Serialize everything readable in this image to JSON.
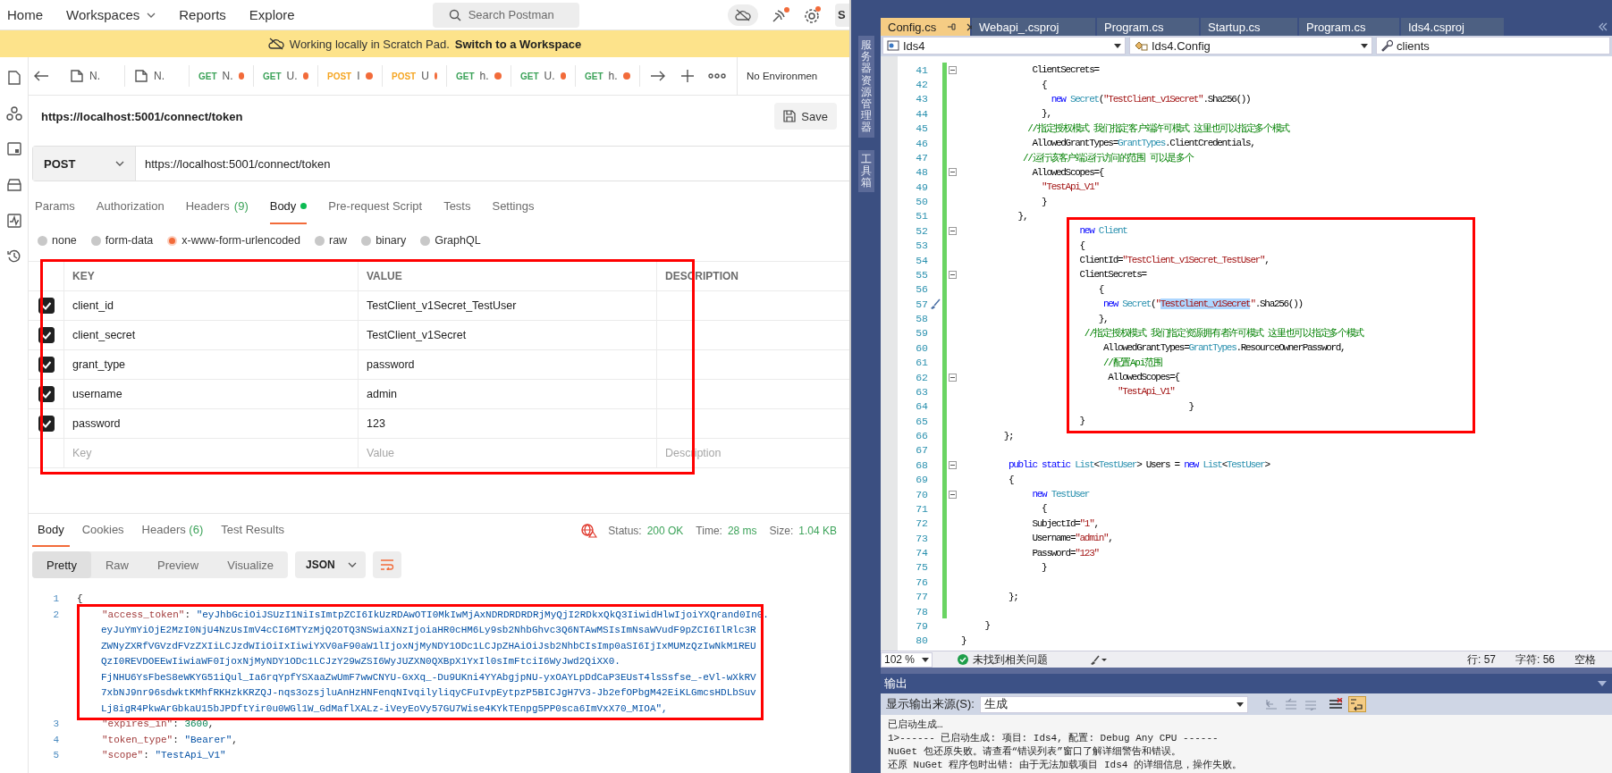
{
  "postman": {
    "nav": {
      "items": [
        {
          "label": "Home",
          "dropdown": false
        },
        {
          "label": "Workspaces",
          "dropdown": true
        },
        {
          "label": "Reports",
          "dropdown": false
        },
        {
          "label": "Explore",
          "dropdown": false
        }
      ],
      "search": {
        "placeholder": "Search Postman"
      },
      "account": "S"
    },
    "banner": {
      "text": "Working locally in Scratch Pad.",
      "link": "Switch to a Workspace"
    },
    "request_tabs": [
      {
        "kind": "doc",
        "name": "N."
      },
      {
        "kind": "doc",
        "name": "N."
      },
      {
        "kind": "request",
        "method": "GET",
        "color": "#3da35a",
        "name": "N.",
        "unsaved": true
      },
      {
        "kind": "request",
        "method": "GET",
        "color": "#3da35a",
        "name": "U.",
        "unsaved": true
      },
      {
        "kind": "request",
        "method": "POST",
        "color": "#f5a623",
        "name": "I",
        "unsaved": true
      },
      {
        "kind": "request",
        "method": "POST",
        "color": "#f5a623",
        "name": "U",
        "unsaved": true
      },
      {
        "kind": "request",
        "method": "GET",
        "color": "#3da35a",
        "name": "h.",
        "unsaved": true
      },
      {
        "kind": "request",
        "method": "GET",
        "color": "#3da35a",
        "name": "U.",
        "unsaved": true
      },
      {
        "kind": "request",
        "method": "GET",
        "color": "#3da35a",
        "name": "h.",
        "unsaved": true
      }
    ],
    "environment": "No Environmen",
    "request": {
      "title": "https://localhost:5001/connect/token",
      "save": "Save",
      "method": "POST",
      "url": "https://localhost:5001/connect/token"
    },
    "request_sections": [
      {
        "label": "Params",
        "dot": false,
        "selected": false
      },
      {
        "label": "Authorization",
        "dot": false,
        "selected": false
      },
      {
        "label": "Headers",
        "count": "(9)",
        "dot": false,
        "selected": false
      },
      {
        "label": "Body",
        "dot": true,
        "selected": true
      },
      {
        "label": "Pre-request Script",
        "dot": false,
        "selected": false
      },
      {
        "label": "Tests",
        "dot": false,
        "selected": false
      },
      {
        "label": "Settings",
        "dot": false,
        "selected": false
      }
    ],
    "body_types": [
      {
        "label": "none",
        "selected": false
      },
      {
        "label": "form-data",
        "selected": false
      },
      {
        "label": "x-www-form-urlencoded",
        "selected": true
      },
      {
        "label": "raw",
        "selected": false
      },
      {
        "label": "binary",
        "selected": false
      },
      {
        "label": "GraphQL",
        "selected": false
      }
    ],
    "params_table": {
      "columns": [
        "KEY",
        "VALUE",
        "DESCRIPTION"
      ],
      "rows": [
        {
          "checked": true,
          "key": "client_id",
          "value": "TestClient_v1Secret_TestUser"
        },
        {
          "checked": true,
          "key": "client_secret",
          "value": "TestClient_v1Secret"
        },
        {
          "checked": true,
          "key": "grant_type",
          "value": "password"
        },
        {
          "checked": true,
          "key": "username",
          "value": "admin"
        },
        {
          "checked": true,
          "key": "password",
          "value": "123"
        }
      ],
      "placeholders": [
        "Key",
        "Value",
        "Description"
      ]
    },
    "response_tabs": [
      {
        "label": "Body",
        "selected": true
      },
      {
        "label": "Cookies",
        "selected": false
      },
      {
        "label": "Headers",
        "count": "(6)",
        "selected": false
      },
      {
        "label": "Test Results",
        "selected": false
      }
    ],
    "response_status": [
      {
        "label": "Status:",
        "value": "200 OK"
      },
      {
        "label": "Time:",
        "value": "28 ms"
      },
      {
        "label": "Size:",
        "value": "1.04 KB"
      }
    ],
    "view_modes": [
      {
        "label": "Pretty",
        "selected": true
      },
      {
        "label": "Raw",
        "selected": false
      },
      {
        "label": "Preview",
        "selected": false
      },
      {
        "label": "Visualize",
        "selected": false
      }
    ],
    "format": "JSON",
    "response_lines": [
      {
        "number": "1",
        "tokens": [
          {
            "kind": "punct",
            "text": "{"
          }
        ]
      },
      {
        "number": "2",
        "tokens": [
          {
            "kind": "key",
            "text": "\"access_token\""
          },
          {
            "kind": "punct",
            "text": ": "
          },
          {
            "kind": "string",
            "text": "\"eyJhbGciOiJSUzI1NiIsImtpZCI6IkUzRDAwOTI0MkIwMjAxNDRDRDRDRjMyQjI2RDkxQkQ3IiwidHlwIjoiYXQrand0In0."
          }
        ],
        "wrapped": [
          "eyJuYmYiOjE2MzI0NjU4NzUsImV4cCI6MTYzMjQ2OTQ3NSwiaXNzIjoiaHR0cHM6Ly9sb2NhbGhvc3Q6NTAwMSIsImNsaWVudF9pZCI6IlRlc3R",
          "ZWNyZXRfVGVzdFVzZXIiLCJzdWIiOiIxIiwiYXV0aF90aW1lIjoxNjMyNDY1ODc1LCJpZHAiOiJsb2NhbCIsImp0aSI6IjIxMUMzQzIwNkM1REU",
          "QzI0REVDOEEwIiwiaWF0IjoxNjMyNDY1ODc1LCJzY29wZSI6WyJUZXN0QXBpX1YxIl0sImFtciI6WyJwd2QiXX0.",
          "FjNHU6YsFbeS8eWKYG51iQul_Ia6rqYpfYSXaaZwUmF7wwCNYU-GxXq_-Du9UKni4YYAbgjpNU-yxOAYLpDdCaP3EUsT4lsSsfse_-eVl-wXkRV",
          "7xbNJ9nr96sdwktKMhfRKHzkKRZQJ-nqs3ozsjluAnHzHNFenqNIvqilyliqyCFuIvpEytpzP5BICJgH7V3-Jb2efOPbgM42EiKLGmcsHDLbSuv",
          "Lj8igR4PkwArGbkaU15bJPDftYir0u0WGl1W_GdMaflXALz-iVeyEoVy57GU7Wise4KYkTEnpg5PP0sca6ImVxX70_MIOA\","
        ]
      },
      {
        "number": "3",
        "tokens": [
          {
            "kind": "key",
            "text": "\"expires_in\""
          },
          {
            "kind": "punct",
            "text": ": "
          },
          {
            "kind": "number",
            "text": "3600"
          },
          {
            "kind": "punct",
            "text": ","
          }
        ]
      },
      {
        "number": "4",
        "tokens": [
          {
            "kind": "key",
            "text": "\"token_type\""
          },
          {
            "kind": "punct",
            "text": ": "
          },
          {
            "kind": "string",
            "text": "\"Bearer\""
          },
          {
            "kind": "punct",
            "text": ","
          }
        ]
      },
      {
        "number": "5",
        "tokens": [
          {
            "kind": "key",
            "text": "\"scope\""
          },
          {
            "kind": "punct",
            "text": ": "
          },
          {
            "kind": "string",
            "text": "\"TestApi_V1\""
          }
        ]
      }
    ]
  },
  "visual_studio": {
    "side_tabs": [
      "服务器资源管理器",
      "工具箱"
    ],
    "doc_tabs": [
      {
        "label": "Config.cs",
        "selected": true
      },
      {
        "label": "Webapi_.csproj",
        "selected": false
      },
      {
        "label": "Program.cs",
        "selected": false
      },
      {
        "label": "Startup.cs",
        "selected": false
      },
      {
        "label": "Program.cs",
        "selected": false
      },
      {
        "label": "Ids4.csproj",
        "selected": false
      }
    ],
    "nav": [
      {
        "kind": "project",
        "label": "Ids4"
      },
      {
        "kind": "class",
        "label": "Ids4.Config"
      },
      {
        "kind": "member",
        "label": "clients"
      }
    ],
    "code_lines": [
      {
        "number": "41",
        "changed": true,
        "fold": true,
        "quick_action": false,
        "tokens": [
          {
            "kind": "plain",
            "text": "               ClientSecrets="
          }
        ]
      },
      {
        "number": "42",
        "changed": true,
        "fold": false,
        "quick_action": false,
        "tokens": [
          {
            "kind": "plain",
            "text": "                 {"
          }
        ]
      },
      {
        "number": "43",
        "changed": true,
        "fold": false,
        "quick_action": false,
        "tokens": [
          {
            "kind": "keyword",
            "text": "                   new "
          },
          {
            "kind": "type",
            "text": "Secret"
          },
          {
            "kind": "plain",
            "text": "("
          },
          {
            "kind": "string",
            "text": "\"TestClient_v1Secret\""
          },
          {
            "kind": "plain",
            "text": ".Sha256())"
          }
        ]
      },
      {
        "number": "44",
        "changed": true,
        "fold": false,
        "quick_action": false,
        "tokens": [
          {
            "kind": "plain",
            "text": "                 },"
          }
        ]
      },
      {
        "number": "45",
        "changed": true,
        "fold": false,
        "quick_action": false,
        "tokens": [
          {
            "kind": "comment",
            "text": "              //指定授权模式 我们指定客户端许可模式 这里也可以指定多个模式"
          }
        ]
      },
      {
        "number": "46",
        "changed": true,
        "fold": false,
        "quick_action": false,
        "tokens": [
          {
            "kind": "plain",
            "text": "               AllowedGrantTypes="
          },
          {
            "kind": "type",
            "text": "GrantTypes"
          },
          {
            "kind": "plain",
            "text": ".ClientCredentials,"
          }
        ]
      },
      {
        "number": "47",
        "changed": true,
        "fold": false,
        "quick_action": false,
        "tokens": [
          {
            "kind": "comment",
            "text": "             //运行该客户端运行访问的范围 可以是多个"
          }
        ]
      },
      {
        "number": "48",
        "changed": true,
        "fold": true,
        "quick_action": false,
        "tokens": [
          {
            "kind": "plain",
            "text": "               AllowedScopes={"
          }
        ]
      },
      {
        "number": "49",
        "changed": true,
        "fold": false,
        "quick_action": false,
        "tokens": [
          {
            "kind": "string",
            "text": "                 \"TestApi_V1\""
          }
        ]
      },
      {
        "number": "50",
        "changed": true,
        "fold": false,
        "quick_action": false,
        "tokens": [
          {
            "kind": "plain",
            "text": "                 }"
          }
        ]
      },
      {
        "number": "51",
        "changed": true,
        "fold": false,
        "quick_action": false,
        "tokens": [
          {
            "kind": "plain",
            "text": "            },"
          }
        ]
      },
      {
        "number": "52",
        "changed": true,
        "fold": true,
        "quick_action": false,
        "tokens": [
          {
            "kind": "keyword",
            "text": "                         new "
          },
          {
            "kind": "type",
            "text": "Client"
          }
        ]
      },
      {
        "number": "53",
        "changed": true,
        "fold": false,
        "quick_action": false,
        "tokens": [
          {
            "kind": "plain",
            "text": "                         {"
          }
        ]
      },
      {
        "number": "54",
        "changed": true,
        "fold": false,
        "quick_action": false,
        "tokens": [
          {
            "kind": "plain",
            "text": "                         ClientId="
          },
          {
            "kind": "string",
            "text": "\"TestClient_v1Secret_TestUser\""
          },
          {
            "kind": "plain",
            "text": ","
          }
        ]
      },
      {
        "number": "55",
        "changed": true,
        "fold": true,
        "quick_action": false,
        "tokens": [
          {
            "kind": "plain",
            "text": "                         ClientSecrets="
          }
        ]
      },
      {
        "number": "56",
        "changed": true,
        "fold": false,
        "quick_action": false,
        "tokens": [
          {
            "kind": "plain",
            "text": "                             {"
          }
        ]
      },
      {
        "number": "57",
        "changed": true,
        "fold": false,
        "quick_action": true,
        "tokens": [
          {
            "kind": "keyword",
            "text": "                              new "
          },
          {
            "kind": "type",
            "text": "Secret"
          },
          {
            "kind": "plain",
            "text": "("
          },
          {
            "kind": "string",
            "text": "\""
          },
          {
            "kind": "selection",
            "text": "TestClient_v1Secret"
          },
          {
            "kind": "string",
            "text": "\""
          },
          {
            "kind": "plain",
            "text": ".Sha256())"
          }
        ]
      },
      {
        "number": "58",
        "changed": true,
        "fold": false,
        "quick_action": false,
        "tokens": [
          {
            "kind": "plain",
            "text": "                             },"
          }
        ]
      },
      {
        "number": "59",
        "changed": true,
        "fold": false,
        "quick_action": false,
        "tokens": [
          {
            "kind": "comment",
            "text": "                          //指定授权模式 我们指定资源拥有者许可模式 这里也可以指定多个模式"
          }
        ]
      },
      {
        "number": "60",
        "changed": true,
        "fold": false,
        "quick_action": false,
        "tokens": [
          {
            "kind": "plain",
            "text": "                              AllowedGrantTypes="
          },
          {
            "kind": "type",
            "text": "GrantTypes"
          },
          {
            "kind": "plain",
            "text": ".ResourceOwnerPassword,"
          }
        ]
      },
      {
        "number": "61",
        "changed": true,
        "fold": false,
        "quick_action": false,
        "tokens": [
          {
            "kind": "comment",
            "text": "                              //配置Api范围"
          }
        ]
      },
      {
        "number": "62",
        "changed": true,
        "fold": true,
        "quick_action": false,
        "tokens": [
          {
            "kind": "plain",
            "text": "                               AllowedScopes={"
          }
        ]
      },
      {
        "number": "63",
        "changed": true,
        "fold": false,
        "quick_action": false,
        "tokens": [
          {
            "kind": "string",
            "text": "                                 \"TestApi_V1\""
          }
        ]
      },
      {
        "number": "64",
        "changed": true,
        "fold": false,
        "quick_action": false,
        "tokens": [
          {
            "kind": "plain",
            "text": "                                                }"
          }
        ]
      },
      {
        "number": "65",
        "changed": true,
        "fold": false,
        "quick_action": false,
        "tokens": [
          {
            "kind": "plain",
            "text": "                         }"
          }
        ]
      },
      {
        "number": "66",
        "changed": true,
        "fold": false,
        "quick_action": false,
        "tokens": [
          {
            "kind": "plain",
            "text": "         };"
          }
        ]
      },
      {
        "number": "67",
        "changed": true,
        "fold": false,
        "quick_action": false
      },
      {
        "number": "68",
        "changed": true,
        "fold": true,
        "quick_action": false,
        "tokens": [
          {
            "kind": "keyword",
            "text": "          public static "
          },
          {
            "kind": "type",
            "text": "List"
          },
          {
            "kind": "plain",
            "text": "<"
          },
          {
            "kind": "type",
            "text": "TestUser"
          },
          {
            "kind": "plain",
            "text": "> Users = "
          },
          {
            "kind": "keyword",
            "text": "new "
          },
          {
            "kind": "type",
            "text": "List"
          },
          {
            "kind": "plain",
            "text": "<"
          },
          {
            "kind": "type",
            "text": "TestUser"
          },
          {
            "kind": "plain",
            "text": ">"
          }
        ]
      },
      {
        "number": "69",
        "changed": true,
        "fold": false,
        "quick_action": false,
        "tokens": [
          {
            "kind": "plain",
            "text": "          {"
          }
        ]
      },
      {
        "number": "70",
        "changed": true,
        "fold": true,
        "quick_action": false,
        "tokens": [
          {
            "kind": "keyword",
            "text": "               new "
          },
          {
            "kind": "type",
            "text": "TestUser"
          }
        ]
      },
      {
        "number": "71",
        "changed": true,
        "fold": false,
        "quick_action": false,
        "tokens": [
          {
            "kind": "plain",
            "text": "                 {"
          }
        ]
      },
      {
        "number": "72",
        "changed": true,
        "fold": false,
        "quick_action": false,
        "tokens": [
          {
            "kind": "plain",
            "text": "               SubjectId="
          },
          {
            "kind": "string",
            "text": "\"1\""
          },
          {
            "kind": "plain",
            "text": ","
          }
        ]
      },
      {
        "number": "73",
        "changed": true,
        "fold": false,
        "quick_action": false,
        "tokens": [
          {
            "kind": "plain",
            "text": "               Username="
          },
          {
            "kind": "string",
            "text": "\"admin\""
          },
          {
            "kind": "plain",
            "text": ","
          }
        ]
      },
      {
        "number": "74",
        "changed": true,
        "fold": false,
        "quick_action": false,
        "tokens": [
          {
            "kind": "plain",
            "text": "               Password="
          },
          {
            "kind": "string",
            "text": "\"123\""
          }
        ]
      },
      {
        "number": "75",
        "changed": true,
        "fold": false,
        "quick_action": false,
        "tokens": [
          {
            "kind": "plain",
            "text": "                 }"
          }
        ]
      },
      {
        "number": "76",
        "changed": true,
        "fold": false,
        "quick_action": false
      },
      {
        "number": "77",
        "changed": true,
        "fold": false,
        "quick_action": false,
        "tokens": [
          {
            "kind": "plain",
            "text": "          };"
          }
        ]
      },
      {
        "number": "78",
        "changed": true,
        "fold": false,
        "quick_action": false
      },
      {
        "number": "79",
        "changed": false,
        "fold": false,
        "quick_action": false,
        "tokens": [
          {
            "kind": "plain",
            "text": "     }"
          }
        ]
      },
      {
        "number": "80",
        "changed": false,
        "fold": false,
        "quick_action": false,
        "tokens": [
          {
            "kind": "plain",
            "text": "}"
          }
        ]
      }
    ],
    "status": {
      "zoom": "102 %",
      "issues": "未找到相关问题",
      "position": [
        "行: 57",
        "字符: 56",
        "空格"
      ]
    },
    "output": {
      "title": "输出",
      "source_label": "显示输出来源(S):",
      "source": "生成",
      "lines": [
        "已启动生成…",
        "1>------ 已启动生成: 项目: Ids4, 配置: Debug Any CPU ------",
        "NuGet 包还原失败。请查看“错误列表”窗口了解详细警告和错误。",
        "还原 NuGet 程序包时出错: 由于无法加载项目 Ids4 的详细信息，操作失败。"
      ]
    }
  }
}
